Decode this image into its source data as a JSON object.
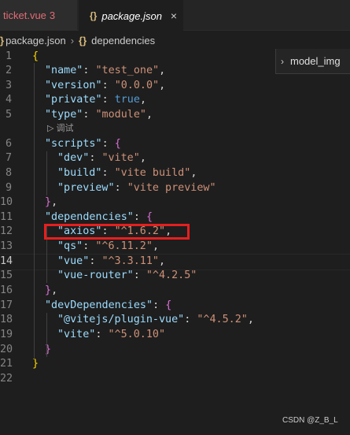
{
  "tabs": [
    {
      "name": "ticket.vue",
      "badge": "3"
    },
    {
      "icon": "{}",
      "name": "package.json",
      "close": "×"
    }
  ],
  "breadcrumb": {
    "file": "package.json",
    "icon": "{}",
    "symbol": "dependencies"
  },
  "outline": {
    "label": "model_img"
  },
  "codelens": {
    "label": "调试"
  },
  "lines": [
    {
      "n": "1",
      "tokens": [
        [
          "br1",
          "{"
        ]
      ]
    },
    {
      "n": "2",
      "tokens": [
        [
          "k",
          "\"name\""
        ],
        [
          "p",
          ": "
        ],
        [
          "s",
          "\"test_one\""
        ],
        [
          "p",
          ","
        ]
      ]
    },
    {
      "n": "3",
      "tokens": [
        [
          "k",
          "\"version\""
        ],
        [
          "p",
          ": "
        ],
        [
          "s",
          "\"0.0.0\""
        ],
        [
          "p",
          ","
        ]
      ]
    },
    {
      "n": "4",
      "tokens": [
        [
          "k",
          "\"private\""
        ],
        [
          "p",
          ": "
        ],
        [
          "b",
          "true"
        ],
        [
          "p",
          ","
        ]
      ]
    },
    {
      "n": "5",
      "tokens": [
        [
          "k",
          "\"type\""
        ],
        [
          "p",
          ": "
        ],
        [
          "s",
          "\"module\""
        ],
        [
          "p",
          ","
        ]
      ]
    },
    {
      "n": "6",
      "tokens": [
        [
          "k",
          "\"scripts\""
        ],
        [
          "p",
          ": "
        ],
        [
          "br2",
          "{"
        ]
      ]
    },
    {
      "n": "7",
      "tokens": [
        [
          "k",
          "\"dev\""
        ],
        [
          "p",
          ": "
        ],
        [
          "s",
          "\"vite\""
        ],
        [
          "p",
          ","
        ]
      ]
    },
    {
      "n": "8",
      "tokens": [
        [
          "k",
          "\"build\""
        ],
        [
          "p",
          ": "
        ],
        [
          "s",
          "\"vite build\""
        ],
        [
          "p",
          ","
        ]
      ]
    },
    {
      "n": "9",
      "tokens": [
        [
          "k",
          "\"preview\""
        ],
        [
          "p",
          ": "
        ],
        [
          "s",
          "\"vite preview\""
        ]
      ]
    },
    {
      "n": "10",
      "tokens": [
        [
          "br2",
          "}"
        ],
        [
          "p",
          ","
        ]
      ]
    },
    {
      "n": "11",
      "tokens": [
        [
          "k",
          "\"dependencies\""
        ],
        [
          "p",
          ": "
        ],
        [
          "br2",
          "{"
        ]
      ]
    },
    {
      "n": "12",
      "tokens": [
        [
          "k",
          "\"axios\""
        ],
        [
          "p",
          ": "
        ],
        [
          "s",
          "\"^1.6.2\""
        ],
        [
          "p",
          ","
        ]
      ]
    },
    {
      "n": "13",
      "tokens": [
        [
          "k",
          "\"qs\""
        ],
        [
          "p",
          ": "
        ],
        [
          "s",
          "\"^6.11.2\""
        ],
        [
          "p",
          ","
        ]
      ]
    },
    {
      "n": "14",
      "tokens": [
        [
          "k",
          "\"vue\""
        ],
        [
          "p",
          ": "
        ],
        [
          "s",
          "\"^3.3.11\""
        ],
        [
          "p",
          ","
        ]
      ]
    },
    {
      "n": "15",
      "tokens": [
        [
          "k",
          "\"vue-router\""
        ],
        [
          "p",
          ": "
        ],
        [
          "s",
          "\"^4.2.5\""
        ]
      ]
    },
    {
      "n": "16",
      "tokens": [
        [
          "br2",
          "}"
        ],
        [
          "p",
          ","
        ]
      ]
    },
    {
      "n": "17",
      "tokens": [
        [
          "k",
          "\"devDependencies\""
        ],
        [
          "p",
          ": "
        ],
        [
          "br2",
          "{"
        ]
      ]
    },
    {
      "n": "18",
      "tokens": [
        [
          "k",
          "\"@vitejs/plugin-vue\""
        ],
        [
          "p",
          ": "
        ],
        [
          "s",
          "\"^4.5.2\""
        ],
        [
          "p",
          ","
        ]
      ]
    },
    {
      "n": "19",
      "tokens": [
        [
          "k",
          "\"vite\""
        ],
        [
          "p",
          ": "
        ],
        [
          "s",
          "\"^5.0.10\""
        ]
      ]
    },
    {
      "n": "20",
      "tokens": [
        [
          "br2",
          "}"
        ]
      ]
    },
    {
      "n": "21",
      "tokens": [
        [
          "br1",
          "}"
        ]
      ]
    },
    {
      "n": "22",
      "tokens": []
    }
  ],
  "current_line": "14",
  "watermark": "CSDN @Z_B_L"
}
